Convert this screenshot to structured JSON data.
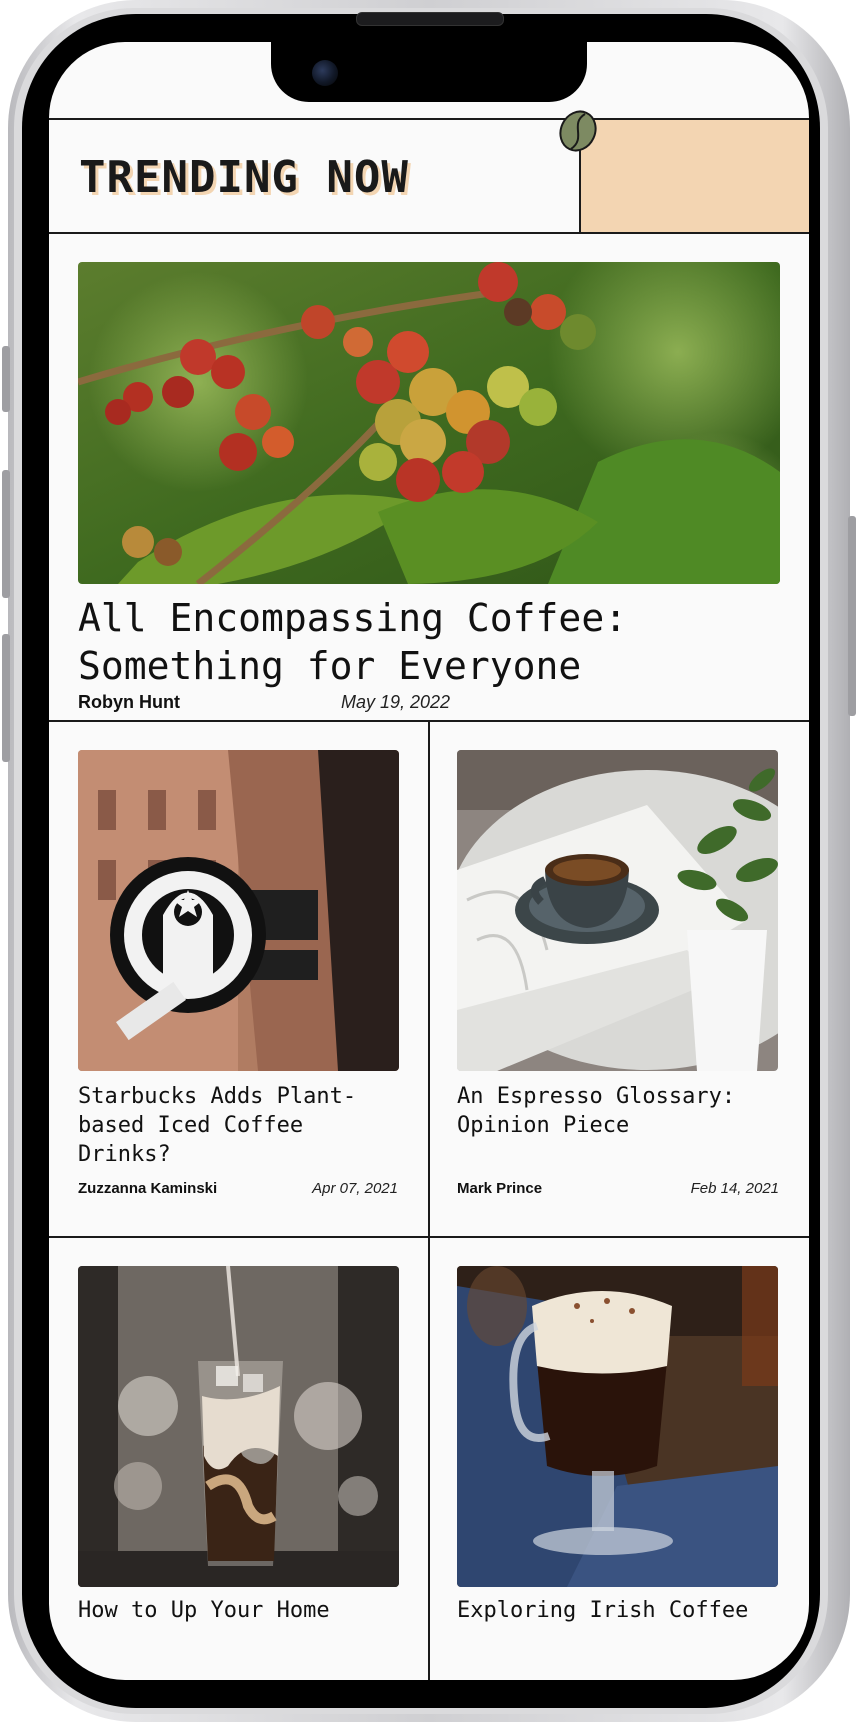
{
  "header": {
    "title": "TRENDING NOW",
    "accent_color": "#f3d5b2",
    "bean_icon": "coffee-bean-icon"
  },
  "featured": {
    "headline": "All Encompassing Coffee: Something for Everyone",
    "author": "Robyn Hunt",
    "date": "May 19, 2022"
  },
  "articles": [
    {
      "headline": "Starbucks Adds Plant-based Iced Coffee Drinks?",
      "author": "Zuzzanna Kaminski",
      "date": "Apr 07, 2021"
    },
    {
      "headline": "An Espresso Glossary: Opinion Piece",
      "author": "Mark Prince",
      "date": "Feb 14, 2021"
    },
    {
      "headline": "How to Up Your Home",
      "author": "",
      "date": ""
    },
    {
      "headline": "Exploring Irish Coffee",
      "author": "",
      "date": ""
    }
  ],
  "colors": {
    "ink": "#1a1a1a",
    "paper": "#fafafa",
    "accent": "#f3d5b2"
  }
}
